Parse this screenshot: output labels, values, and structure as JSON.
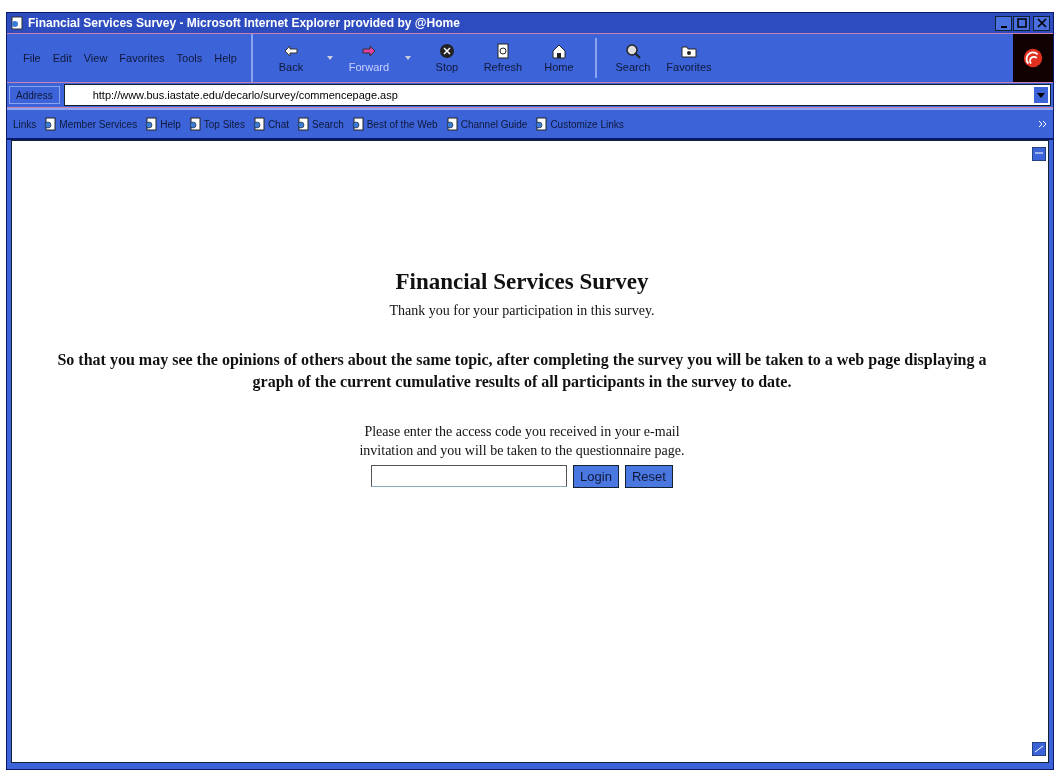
{
  "window": {
    "title": "Financial Services Survey - Microsoft Internet Explorer provided by @Home"
  },
  "menu": [
    "File",
    "Edit",
    "View",
    "Favorites",
    "Tools",
    "Help"
  ],
  "toolbar": [
    {
      "label": "Back",
      "kind": "back",
      "disabled": false
    },
    {
      "label": "Forward",
      "kind": "forward",
      "disabled": true
    },
    {
      "label": "Stop",
      "kind": "stop",
      "disabled": false
    },
    {
      "label": "Refresh",
      "kind": "refresh",
      "disabled": false
    },
    {
      "label": "Home",
      "kind": "home",
      "disabled": false
    },
    {
      "label": "Search",
      "kind": "search",
      "disabled": false
    },
    {
      "label": "Favorites",
      "kind": "favorites",
      "disabled": false
    }
  ],
  "address": {
    "label": "Address",
    "value": "http://www.bus.iastate.edu/decarlo/survey/commencepage.asp"
  },
  "links": {
    "label": "Links",
    "items": [
      "Member Services",
      "Help",
      "Top Sites",
      "Chat",
      "Search",
      "Best of the Web",
      "Channel Guide",
      "Customize Links"
    ]
  },
  "page": {
    "title": "Financial Services Survey",
    "thanks": "Thank you for your participation in this survey.",
    "notice": "So that you may see the opinions of others about the same topic, after completing the survey you will be taken to a  web page displaying a graph of the current cumulative results of all participants in the survey to date.",
    "instructions": [
      "Please enter the access code you received in your e-mail",
      "invitation and you will be taken to the questionnaire page."
    ],
    "buttons": [
      "Login",
      "Reset"
    ]
  }
}
